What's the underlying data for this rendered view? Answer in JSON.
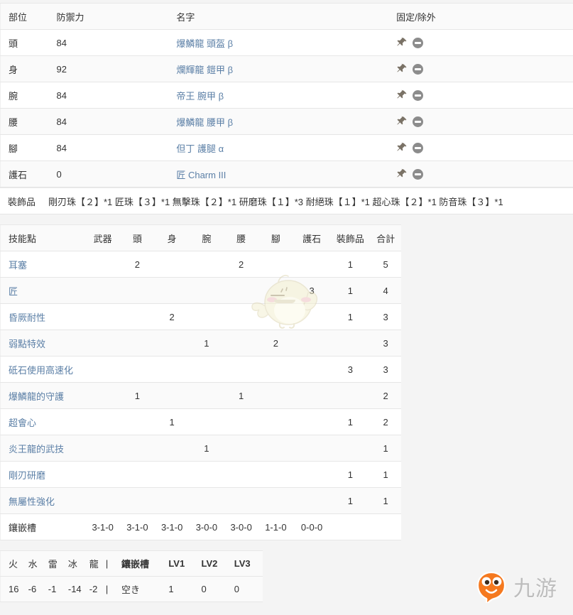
{
  "armor_table": {
    "headers": [
      "部位",
      "防禦力",
      "名字",
      "固定/除外"
    ],
    "rows": [
      {
        "part": "頭",
        "defense": "84",
        "name": "爆鱗龍 頭盔 β",
        "pin_icon": "pin-icon",
        "exclude_icon": "minus-circle-icon"
      },
      {
        "part": "身",
        "defense": "92",
        "name": "爛輝龍 鎧甲 β",
        "pin_icon": "pin-icon",
        "exclude_icon": "minus-circle-icon"
      },
      {
        "part": "腕",
        "defense": "84",
        "name": "帝王 腕甲 β",
        "pin_icon": "pin-icon",
        "exclude_icon": "minus-circle-icon"
      },
      {
        "part": "腰",
        "defense": "84",
        "name": "爆鱗龍 腰甲 β",
        "pin_icon": "pin-icon",
        "exclude_icon": "minus-circle-icon"
      },
      {
        "part": "腳",
        "defense": "84",
        "name": "但丁 護腿 α",
        "pin_icon": "pin-icon",
        "exclude_icon": "minus-circle-icon"
      },
      {
        "part": "護石",
        "defense": "0",
        "name": "匠 Charm III",
        "pin_icon": "pin-icon",
        "exclude_icon": "minus-circle-icon"
      }
    ]
  },
  "deco_row": {
    "label": "裝飾品",
    "value": "剛刃珠【２】*1 匠珠【３】*1 無擊珠【２】*1 研磨珠【１】*3 耐絕珠【１】*1 超心珠【２】*1 防音珠【３】*1"
  },
  "skill_table": {
    "headers": [
      "技能點",
      "武器",
      "頭",
      "身",
      "腕",
      "腰",
      "腳",
      "護石",
      "裝飾品",
      "合計"
    ],
    "rows": [
      {
        "skill": "耳塞",
        "weapon": "",
        "head": "2",
        "body": "",
        "arms": "",
        "waist": "2",
        "legs": "",
        "charm": "",
        "deco": "1",
        "total": "5"
      },
      {
        "skill": "匠",
        "weapon": "",
        "head": "",
        "body": "",
        "arms": "",
        "waist": "",
        "legs": "",
        "charm": "3",
        "deco": "1",
        "total": "4"
      },
      {
        "skill": "昏厥耐性",
        "weapon": "",
        "head": "",
        "body": "2",
        "arms": "",
        "waist": "",
        "legs": "",
        "charm": "",
        "deco": "1",
        "total": "3"
      },
      {
        "skill": "弱點特效",
        "weapon": "",
        "head": "",
        "body": "",
        "arms": "1",
        "waist": "",
        "legs": "2",
        "charm": "",
        "deco": "",
        "total": "3"
      },
      {
        "skill": "砥石使用高速化",
        "weapon": "",
        "head": "",
        "body": "",
        "arms": "",
        "waist": "",
        "legs": "",
        "charm": "",
        "deco": "3",
        "total": "3"
      },
      {
        "skill": "爆鱗龍的守護",
        "weapon": "",
        "head": "1",
        "body": "",
        "arms": "",
        "waist": "1",
        "legs": "",
        "charm": "",
        "deco": "",
        "total": "2"
      },
      {
        "skill": "超會心",
        "weapon": "",
        "head": "",
        "body": "1",
        "arms": "",
        "waist": "",
        "legs": "",
        "charm": "",
        "deco": "1",
        "total": "2"
      },
      {
        "skill": "炎王龍的武技",
        "weapon": "",
        "head": "",
        "body": "",
        "arms": "1",
        "waist": "",
        "legs": "",
        "charm": "",
        "deco": "",
        "total": "1"
      },
      {
        "skill": "剛刃研磨",
        "weapon": "",
        "head": "",
        "body": "",
        "arms": "",
        "waist": "",
        "legs": "",
        "charm": "",
        "deco": "1",
        "total": "1"
      },
      {
        "skill": "無屬性強化",
        "weapon": "",
        "head": "",
        "body": "",
        "arms": "",
        "waist": "",
        "legs": "",
        "charm": "",
        "deco": "1",
        "total": "1"
      }
    ],
    "slot_row": {
      "label": "鑲嵌槽",
      "weapon": "3-1-0",
      "head": "3-1-0",
      "body": "3-1-0",
      "arms": "3-0-0",
      "waist": "3-0-0",
      "legs": "1-1-0",
      "charm": "0-0-0",
      "deco": "",
      "total": ""
    }
  },
  "resist_table": {
    "headers": {
      "fire": "火",
      "water": "水",
      "thunder": "雷",
      "ice": "冰",
      "dragon": "龍",
      "sep": "|",
      "slot": "鑲嵌槽",
      "lv1": "LV1",
      "lv2": "LV2",
      "lv3": "LV3"
    },
    "values": {
      "fire": "16",
      "water": "-6",
      "thunder": "-1",
      "ice": "-14",
      "dragon": "-2",
      "sep": "|",
      "slot": "空き",
      "lv1": "1",
      "lv2": "0",
      "lv3": "0"
    }
  },
  "watermarks": {
    "mascot_icon": "chick-mascot-icon",
    "logo_icon": "jiuyou-mascot-logo-icon",
    "logo_text": "九游"
  },
  "colors": {
    "link": "#5b7fa6",
    "page_bg": "#f4f4f4",
    "table_bg": "#ffffff",
    "stripe_bg": "#fafafa",
    "border": "#e6e6e6",
    "logo_orange": "#f5791f",
    "mascot_body": "#f2eec8"
  }
}
